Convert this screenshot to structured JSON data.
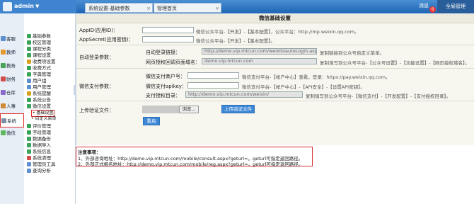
{
  "header": {
    "user": "admin",
    "tabs": [
      {
        "label": "系统设置-基础参数"
      },
      {
        "label": "管理首页"
      }
    ],
    "notify_label": "消息",
    "notify_count": "6",
    "global_button": "全局管理"
  },
  "leftnav": {
    "items": [
      {
        "label": "客服",
        "color": "#5b8fd0"
      },
      {
        "label": "教师",
        "color": "#e49a2e"
      },
      {
        "label": "教务",
        "color": "#4aa35a"
      },
      {
        "label": "财务",
        "color": "#d24a4a"
      },
      {
        "label": "仓库",
        "color": "#8a6bc9"
      },
      {
        "label": "人事",
        "color": "#cf8a34"
      },
      {
        "label": "分析",
        "color": "#3aa0b6"
      },
      {
        "label": "微信",
        "color": "#5cb85c"
      },
      {
        "label": "系统",
        "color": "#7e8ea5"
      }
    ]
  },
  "tree": {
    "nodes": [
      {
        "label": "基础参数",
        "color": "#3aa35a"
      },
      {
        "label": "校区管理",
        "color": "#3aa35a"
      },
      {
        "label": "课程分类",
        "color": "#3aa35a"
      },
      {
        "label": "课程设置",
        "color": "#3aa35a"
      },
      {
        "label": "收费项设置",
        "color": "#d8a020"
      },
      {
        "label": "收费方式",
        "color": "#3aa35a"
      },
      {
        "label": "字典管理",
        "color": "#3aa35a"
      },
      {
        "label": "用户组",
        "color": "#5b8fd0"
      },
      {
        "label": "用户管理",
        "color": "#5b8fd0"
      },
      {
        "label": "系统提醒",
        "color": "#d8a020"
      },
      {
        "label": "系统公告",
        "color": "#3aa35a"
      },
      {
        "label": "微信设置",
        "color": "#3aa35a"
      }
    ],
    "subs": [
      "基础设置",
      "自定义菜单"
    ],
    "nodes2": [
      {
        "label": "评价管理",
        "color": "#3aa35a"
      },
      {
        "label": "字段管理",
        "color": "#3aa35a"
      },
      {
        "label": "数据备份",
        "color": "#3aa35a"
      },
      {
        "label": "数据导入",
        "color": "#3aa35a"
      },
      {
        "label": "系统信息",
        "color": "#3aa35a"
      },
      {
        "label": "系统清理",
        "color": "#d24a4a"
      },
      {
        "label": "管理员工具",
        "color": "#5b8fd0"
      },
      {
        "label": "查询分析",
        "color": "#5b8fd0"
      }
    ]
  },
  "form": {
    "title": "微信基础设置",
    "appid_label": "AppID(应用ID)：",
    "appid_hint": "微信公众平台-【开发】-【基本配置】，公众平台：http://mp.weixin.qq.com。",
    "appsecret_label": "AppSecret(应用密钥)：",
    "appsecret_hint": "微信公众平台-【开发】-【基本配置】。",
    "autologin_section": "自动登录参数：",
    "autologin_link_label": "自动登录链接：",
    "autologin_link_value": "http://demo.vip.mtcun.com/weixin/autoLogin.aspx",
    "autologin_link_hint": "复制链接到公众号自定义菜单。",
    "auth_domain_label": "网页授权回调页面域名：",
    "auth_domain_value": "demo.vip.mtcun.com",
    "auth_domain_hint": "复制填写到公众号平台-【公众号设置】-【功能设置】-【网页授权域名】。",
    "pay_section": "微信支付参数：",
    "mchid_label": "微信支付商户号：",
    "mchid_hint": "微信支付平台-【帐户中心】查看，登录：https://pay.weixin.qq.com。",
    "apikey_label": "微信支付apikey：",
    "apikey_hint": "微信支付平台-【帐户中心】-【API安全】-【设置API密钥】。",
    "paydir_label": "支付授权目录：",
    "paydir_value": "http://demo.vip.mtcun.com/weixin/",
    "paydir_hint": "复制填写到公众号平台-【微信支付】-【开发配置】-【支付授权目录】。",
    "upload_label": "上传验证文件：",
    "browse_label": "浏览...",
    "upload_button": "上传验证文件",
    "save_button": "重启"
  },
  "notes": {
    "title": "注意事项：",
    "line1": "1、外部咨询地址：http://demo.vip.mtcun.com/mobile/consult.aspx?geturl=。geturl可指定返回路径。",
    "line2": "2、外部正式报名地址：http://demo.vip.mtcun.com/mobile/reg.aspx?geturl=。geturl可指定返回路径。"
  },
  "colors": {
    "accent": "#3d87d6",
    "highlight": "#e03030"
  }
}
